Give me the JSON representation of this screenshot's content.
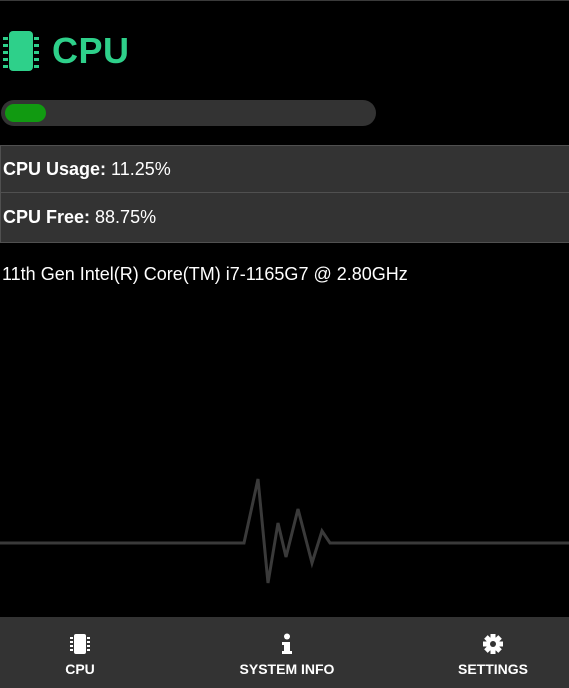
{
  "header": {
    "title": "CPU",
    "icon": "cpu-chip-icon",
    "accent": "#2ed08a"
  },
  "progress": {
    "percent": 11.25,
    "fill_color": "#119a11"
  },
  "stats": {
    "usage_label": "CPU Usage:",
    "usage_value": "11.25%",
    "free_label": "CPU Free:",
    "free_value": "88.75%"
  },
  "cpu_model": "11th Gen Intel(R) Core(TM) i7-1165G7 @ 2.80GHz",
  "nav": {
    "items": [
      {
        "label": "CPU",
        "icon": "cpu-chip-icon"
      },
      {
        "label": "SYSTEM INFO",
        "icon": "info-icon"
      },
      {
        "label": "SETTINGS",
        "icon": "gear-icon"
      }
    ]
  }
}
